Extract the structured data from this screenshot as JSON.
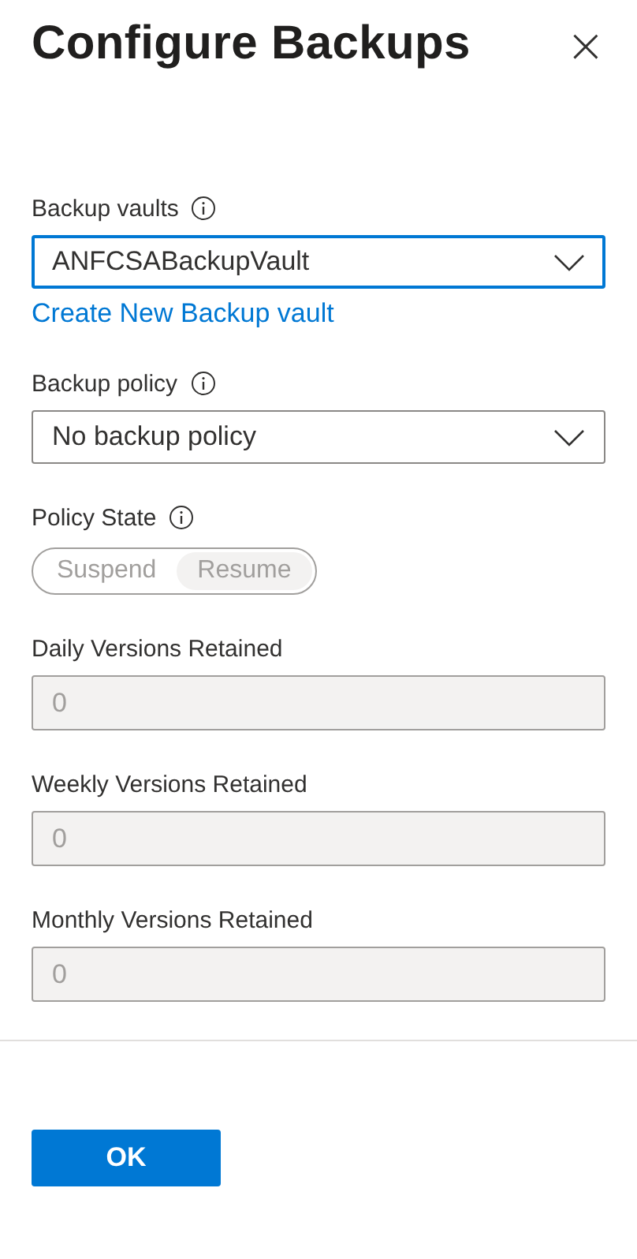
{
  "title": "Configure Backups",
  "close_label": "×",
  "fields": [
    {
      "kind": "dropdown",
      "label": "Backup vaults",
      "info": true,
      "value": "ANFCSABackupVault",
      "focused": true,
      "link": "Create New Backup vault"
    },
    {
      "kind": "dropdown",
      "label": "Backup policy",
      "info": true,
      "value": "No backup policy",
      "focused": false
    },
    {
      "kind": "toggle",
      "label": "Policy State",
      "info": true,
      "disabled": true,
      "options": [
        {
          "label": "Suspend",
          "selected": false
        },
        {
          "label": "Resume",
          "selected": true
        }
      ]
    },
    {
      "kind": "text",
      "label": "Daily Versions Retained",
      "value": "0",
      "disabled": true
    },
    {
      "kind": "text",
      "label": "Weekly Versions Retained",
      "value": "0",
      "disabled": true
    },
    {
      "kind": "text",
      "label": "Monthly Versions Retained",
      "value": "0",
      "disabled": true
    }
  ],
  "ok_button": "OK"
}
